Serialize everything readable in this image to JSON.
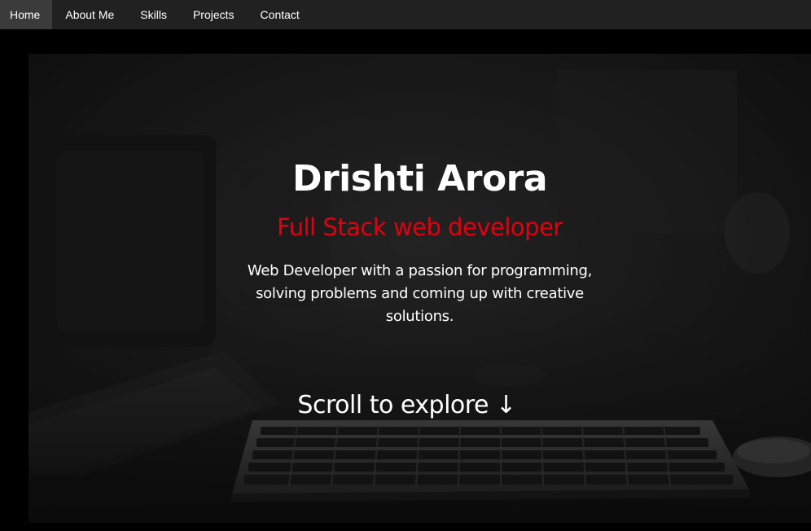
{
  "nav": {
    "items": [
      {
        "label": "Home",
        "active": true
      },
      {
        "label": "About Me"
      },
      {
        "label": "Skills"
      },
      {
        "label": "Projects"
      },
      {
        "label": "Contact"
      }
    ]
  },
  "hero": {
    "name": "Drishti Arora",
    "role": "Full Stack web developer",
    "description": "Web Developer with a passion for programming, solving problems and coming up with creative solutions.",
    "scroll_text": "Scroll to explore ↓"
  },
  "colors": {
    "navbar_bg": "#212121",
    "nav_active_bg": "#3b3b3b",
    "accent_red": "#e3000e",
    "page_bg": "#000000"
  }
}
